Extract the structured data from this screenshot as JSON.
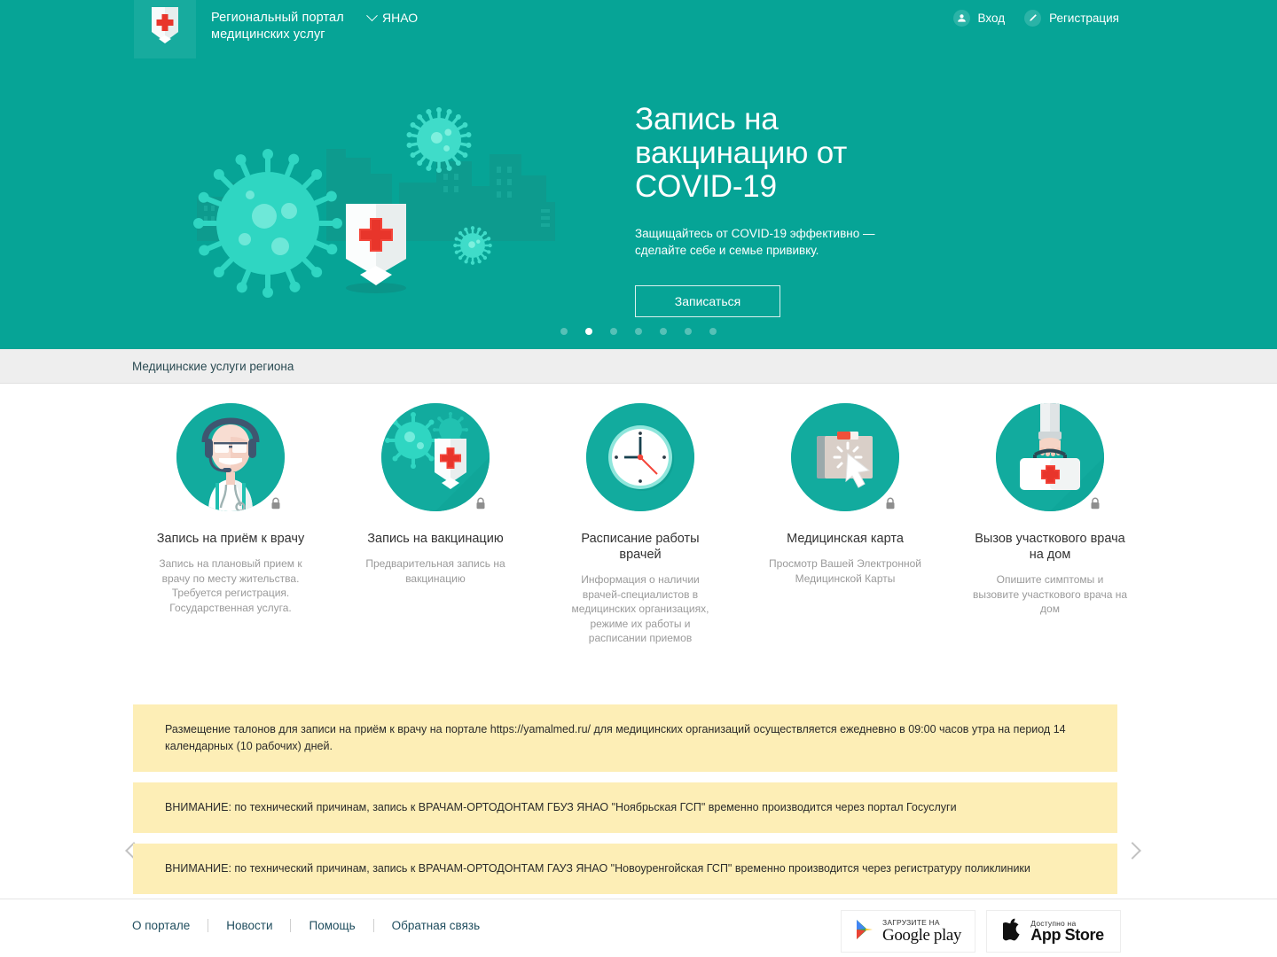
{
  "header": {
    "logo_icon": "shield-cross-logo",
    "brand_line1": "Региональный портал",
    "brand_line2": "медицинских услуг",
    "region": "ЯНАО",
    "region_chevron_icon": "chevron-down-icon",
    "login": {
      "label": "Вход",
      "icon": "user-icon"
    },
    "register": {
      "label": "Регистрация",
      "icon": "pencil-icon"
    }
  },
  "hero": {
    "illustration": "covid-virus-shield-city-illustration",
    "title": "Запись на вакцинацию от COVID-19",
    "subtitle": "Защищайтесь от COVID-19 эффективно — сделайте себе и семье прививку.",
    "button": "Записаться",
    "dots_total": 7,
    "dots_active_index": 1
  },
  "section": {
    "title": "Медицинские услуги региона",
    "prev_icon": "chevron-left-icon",
    "next_icon": "chevron-right-icon"
  },
  "services": [
    {
      "icon": "doctor-headset-icon",
      "locked": true,
      "lock_icon": "lock-icon",
      "title": "Запись на приём к врачу",
      "desc": "Запись на плановый прием к врачу по месту жительства. Требуется регистрация. Государственная услуга."
    },
    {
      "icon": "vaccination-shield-virus-icon",
      "locked": true,
      "lock_icon": "lock-icon",
      "title": "Запись на вакцинацию",
      "desc": "Предварительная запись на вакцинацию"
    },
    {
      "icon": "clock-icon",
      "locked": false,
      "lock_icon": "",
      "title": "Расписание работы врачей",
      "desc": "Информация о наличии врачей-специалистов в медицинских организациях, режиме их работы и расписании приемов"
    },
    {
      "icon": "medical-folder-cursor-icon",
      "locked": true,
      "lock_icon": "lock-icon",
      "title": "Медицинская карта",
      "desc": "Просмотр Вашей Электронной Медицинской Карты"
    },
    {
      "icon": "doctor-bag-hand-icon",
      "locked": true,
      "lock_icon": "lock-icon",
      "title": "Вызов участкового врача на дом",
      "desc": "Опишите симптомы и вызовите участкового врача на дом"
    }
  ],
  "notices": [
    "Размещение талонов для записи на приём к врачу на портале https://yamalmed.ru/ для медицинских организаций осуществляется ежедневно в 09:00 часов утра на период 14 календарных (10 рабочих) дней.",
    "ВНИМАНИЕ: по технический причинам, запись к ВРАЧАМ-ОРТОДОНТАМ ГБУЗ ЯНАО \"Ноябрьская ГСП\" временно производится через портал Госуслуги",
    "ВНИМАНИЕ: по технический причинам, запись к ВРАЧАМ-ОРТОДОНТАМ ГАУЗ ЯНАО \"Новоуренгойская ГСП\" временно производится через регистратуру поликлиники"
  ],
  "footer": {
    "links": [
      "О портале",
      "Новости",
      "Помощь",
      "Обратная связь"
    ],
    "google_play": {
      "top": "ЗАГРУЗИТЕ НА",
      "bottom": "Google play",
      "icon": "google-play-icon"
    },
    "app_store": {
      "top": "Доступно на",
      "bottom": "App Store",
      "icon": "apple-icon"
    }
  },
  "colors": {
    "brand_teal": "#06a496",
    "icon_teal": "#12ab9e",
    "notice_yellow": "#fdeeb6",
    "cross_red": "#e8352b",
    "section_grey": "#eeeeee"
  }
}
